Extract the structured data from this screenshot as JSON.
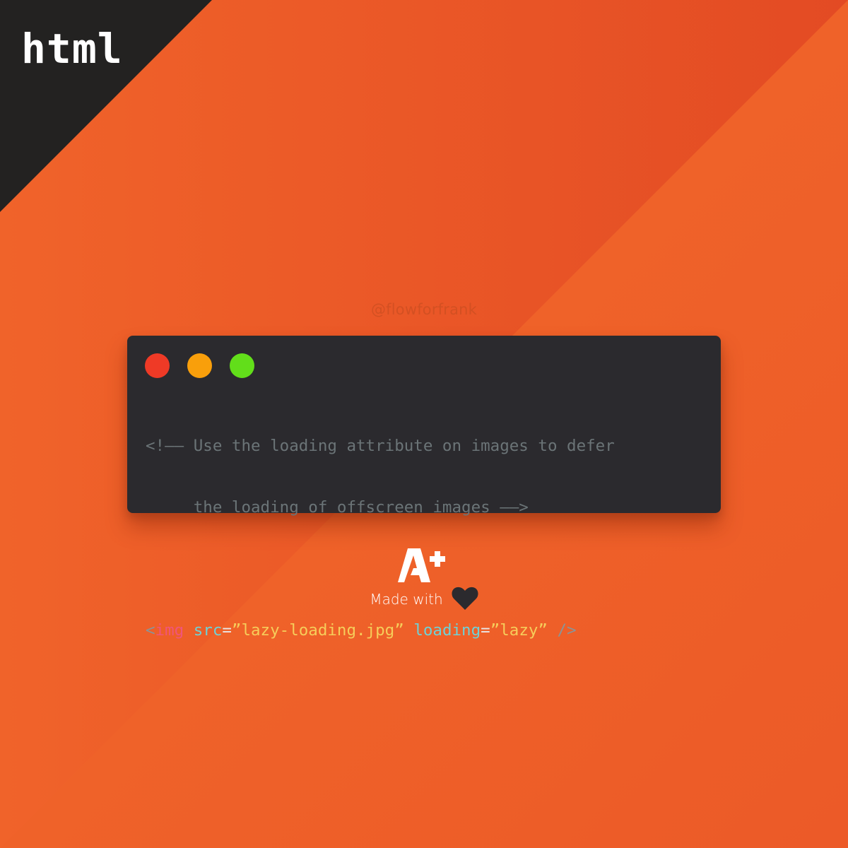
{
  "corner_label": "html",
  "handle": "@flowforfrank",
  "colors": {
    "corner_dark": "#232221",
    "bg_left": "#f0632a",
    "bg_right": "#e44c24",
    "bg_band_dark": "#e34c24",
    "bg_light_triangle": "#f06529",
    "card_bg": "#2b2a2e",
    "dot_red": "#ef3a26",
    "dot_orange": "#f99f0b",
    "dot_green": "#62de1a",
    "comment": "#6b7477",
    "tag": "#f0557a",
    "attribute": "#6fd1d5",
    "string": "#f6cd5a",
    "heart": "#2b2a2e"
  },
  "window": {
    "dots": [
      "close",
      "minimize",
      "maximize"
    ]
  },
  "code": {
    "comment_line_1": "<!—— Use the loading attribute on images to defer",
    "comment_line_2": "     the loading of offscreen images ——>",
    "tokens": {
      "open": "<",
      "tag": "img",
      "attr1": "src",
      "eq1": "=",
      "val1": "”lazy-loading.jpg”",
      "attr2": "loading",
      "eq2": "=",
      "val2": "”lazy”",
      "close": "/>"
    }
  },
  "footer": {
    "logo_text": "A+",
    "made_with": "Made with"
  }
}
